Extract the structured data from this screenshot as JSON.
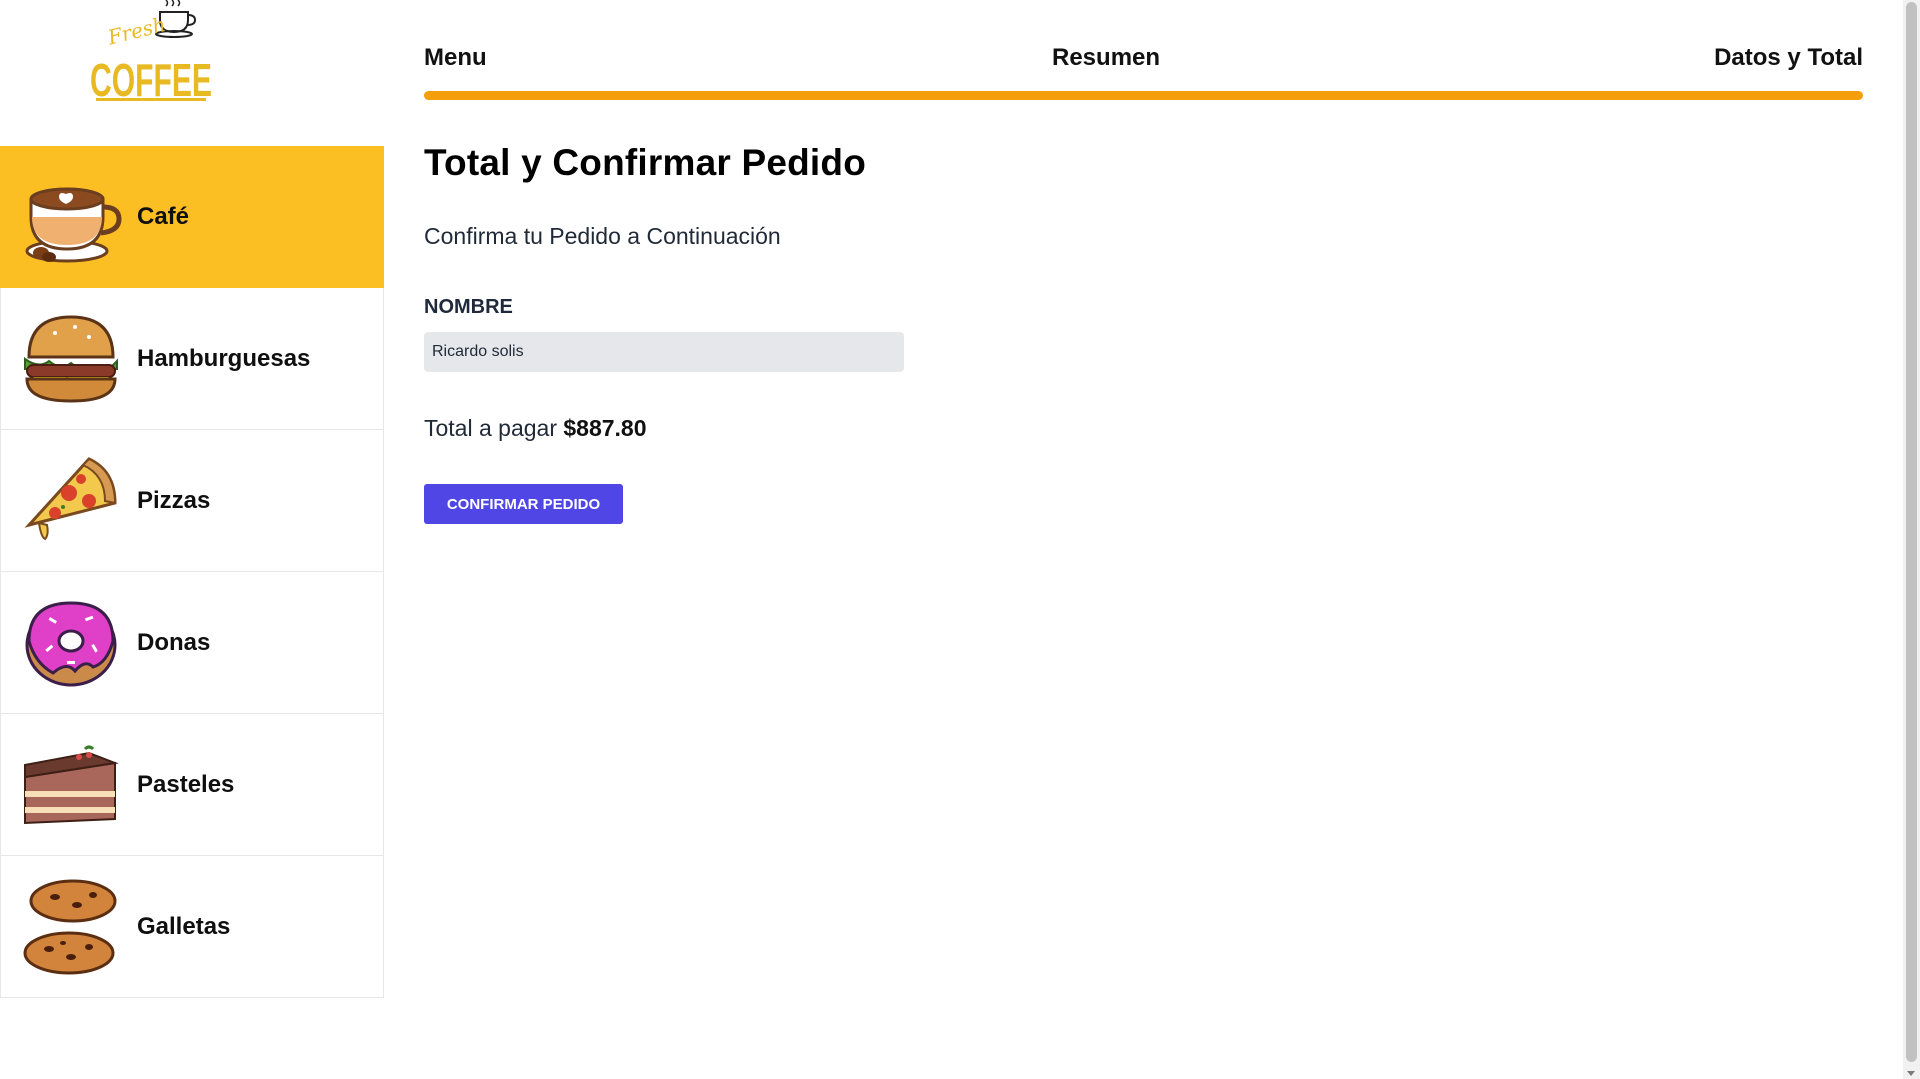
{
  "logo": {
    "word_small": "Fresh",
    "word_main": "COFFEE",
    "color": "#e8b923"
  },
  "sidebar": {
    "active_color": "#fbbf24",
    "items": [
      {
        "label": "Café",
        "icon": "coffee-cup-icon",
        "active": true
      },
      {
        "label": "Hamburguesas",
        "icon": "burger-icon",
        "active": false
      },
      {
        "label": "Pizzas",
        "icon": "pizza-slice-icon",
        "active": false
      },
      {
        "label": "Donas",
        "icon": "donut-icon",
        "active": false
      },
      {
        "label": "Pasteles",
        "icon": "cake-slice-icon",
        "active": false
      },
      {
        "label": "Galletas",
        "icon": "cookies-icon",
        "active": false
      }
    ]
  },
  "steps": {
    "items": [
      {
        "label": "Menu"
      },
      {
        "label": "Resumen"
      },
      {
        "label": "Datos y Total"
      }
    ],
    "progress": 1.0,
    "progress_color": "#f59e0b"
  },
  "main": {
    "title": "Total y Confirmar Pedido",
    "subtitle": "Confirma tu Pedido a Continuación",
    "form": {
      "name_label": "Nombre",
      "name_value": "Ricardo solis"
    },
    "total_label": "Total a pagar",
    "total_value": "$887.80",
    "confirm_label": "Confirmar Pedido",
    "confirm_color": "#4f46e5"
  }
}
